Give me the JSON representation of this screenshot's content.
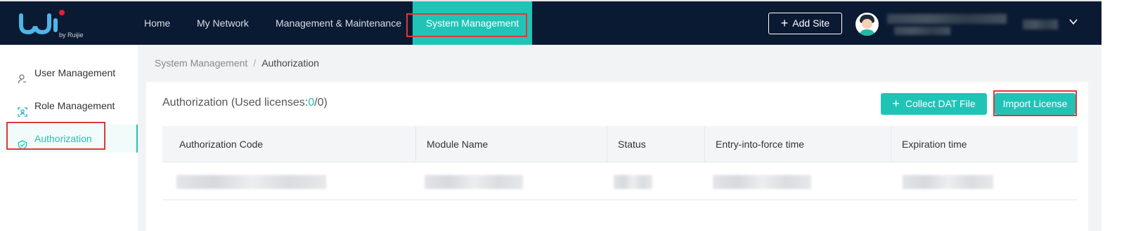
{
  "header": {
    "logo_by": "by Ruijie",
    "nav": [
      "Home",
      "My Network",
      "Management & Maintenance",
      "System Management"
    ],
    "add_site_label": "Add Site"
  },
  "sidebar": {
    "items": [
      {
        "label": "User Management",
        "icon": "user-icon"
      },
      {
        "label": "Role Management",
        "icon": "role-icon"
      },
      {
        "label": "Authorization",
        "icon": "authorization-icon",
        "active": true
      }
    ]
  },
  "breadcrumb": {
    "parent": "System Management",
    "separator": "/",
    "current": "Authorization"
  },
  "authorization": {
    "title_prefix": "Authorization (Used licenses:",
    "used": "0",
    "slash": "/",
    "total": "0",
    "title_suffix": ")",
    "collect_button": "Collect DAT File",
    "import_button": "Import License",
    "columns": [
      "Authorization Code",
      "Module Name",
      "Status",
      "Entry-into-force time",
      "Expiration time"
    ]
  },
  "colors": {
    "accent": "#20c4b6",
    "topbar": "#0b1a33",
    "highlight_outline": "#e0363c"
  }
}
